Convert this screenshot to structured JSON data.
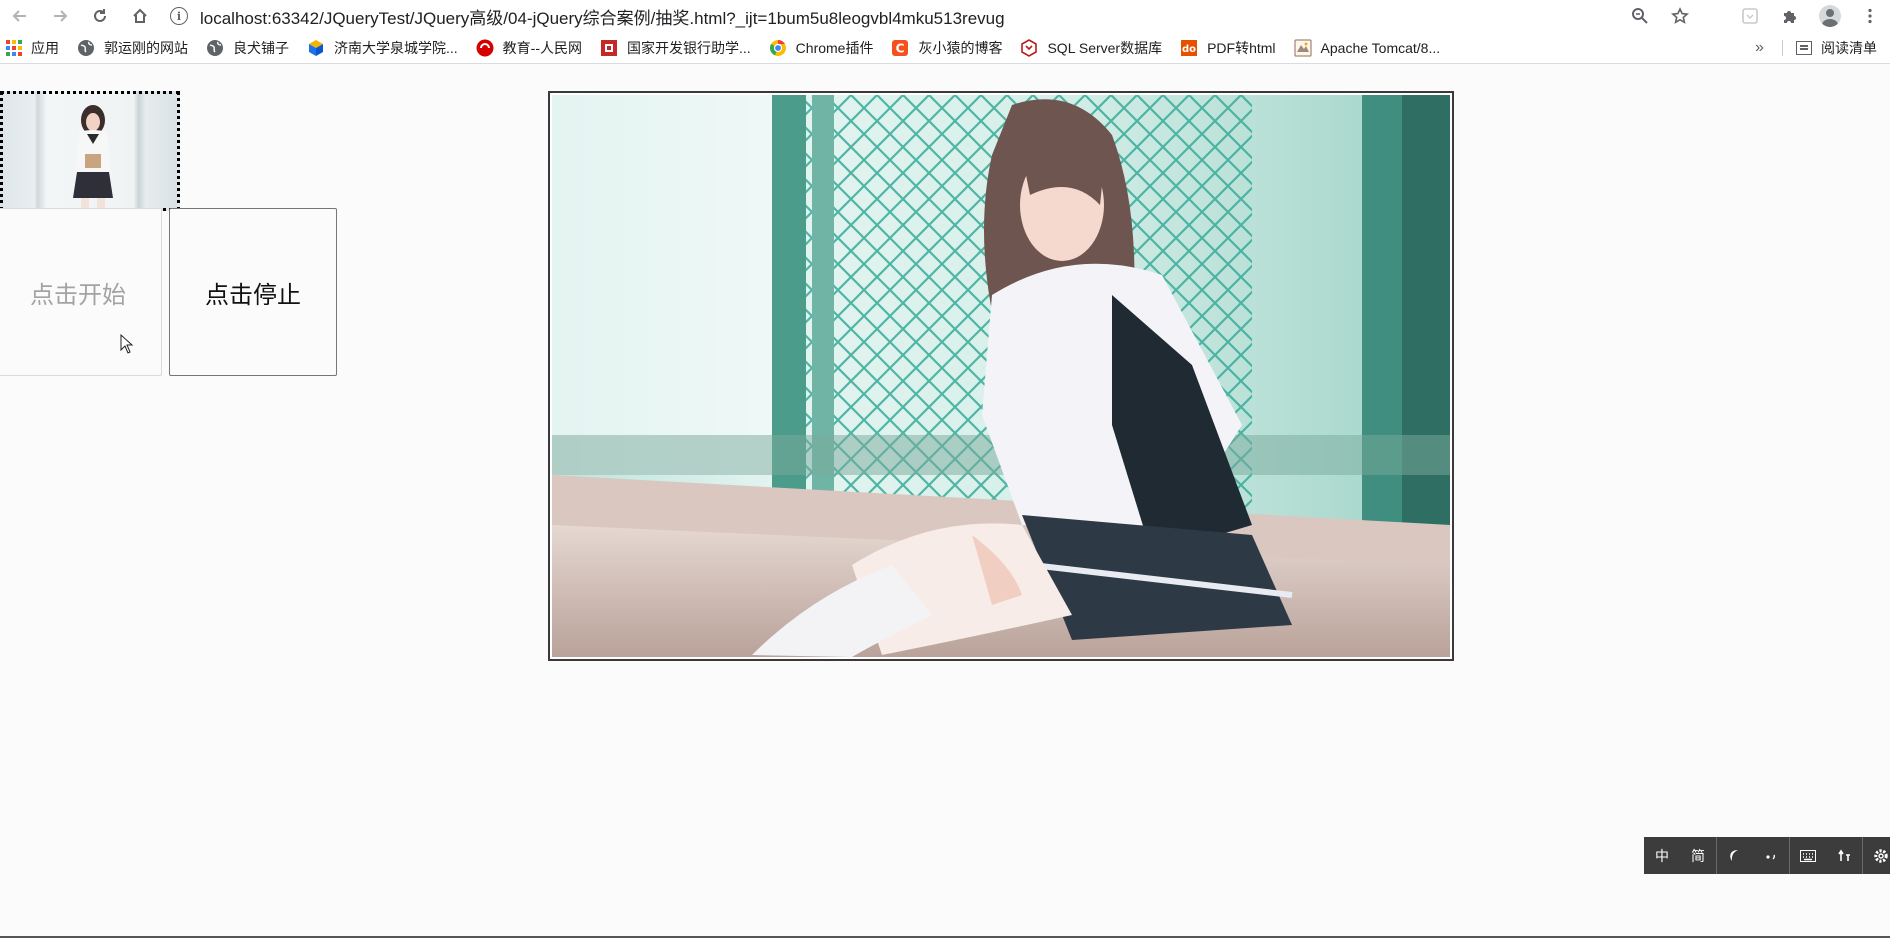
{
  "browser": {
    "url": "localhost:63342/JQueryTest/JQuery高级/04-jQuery综合案例/抽奖.html?_ijt=1bum5u8leogvbl4mku513revug"
  },
  "bookmarks": {
    "items": [
      {
        "label": "应用",
        "icon": "apps-icon"
      },
      {
        "label": "郭运刚的网站",
        "icon": "globe-icon"
      },
      {
        "label": "良犬铺子",
        "icon": "globe-icon"
      },
      {
        "label": "济南大学泉城学院...",
        "icon": "cube-icon"
      },
      {
        "label": "教育--人民网",
        "icon": "people-daily-icon"
      },
      {
        "label": "国家开发银行助学...",
        "icon": "bank-icon"
      },
      {
        "label": "Chrome插件",
        "icon": "chrome-icon"
      },
      {
        "label": "灰小猿的博客",
        "icon": "csdn-icon"
      },
      {
        "label": "SQL Server数据库",
        "icon": "sql-server-icon"
      },
      {
        "label": "PDF转html",
        "icon": "pdf-icon"
      },
      {
        "label": "Apache Tomcat/8...",
        "icon": "tomcat-icon"
      }
    ],
    "more": "»",
    "reading_list": "阅读清单"
  },
  "page": {
    "start_button": "点击开始",
    "stop_button": "点击停止"
  },
  "ime": {
    "lang": "中",
    "script": "简"
  }
}
